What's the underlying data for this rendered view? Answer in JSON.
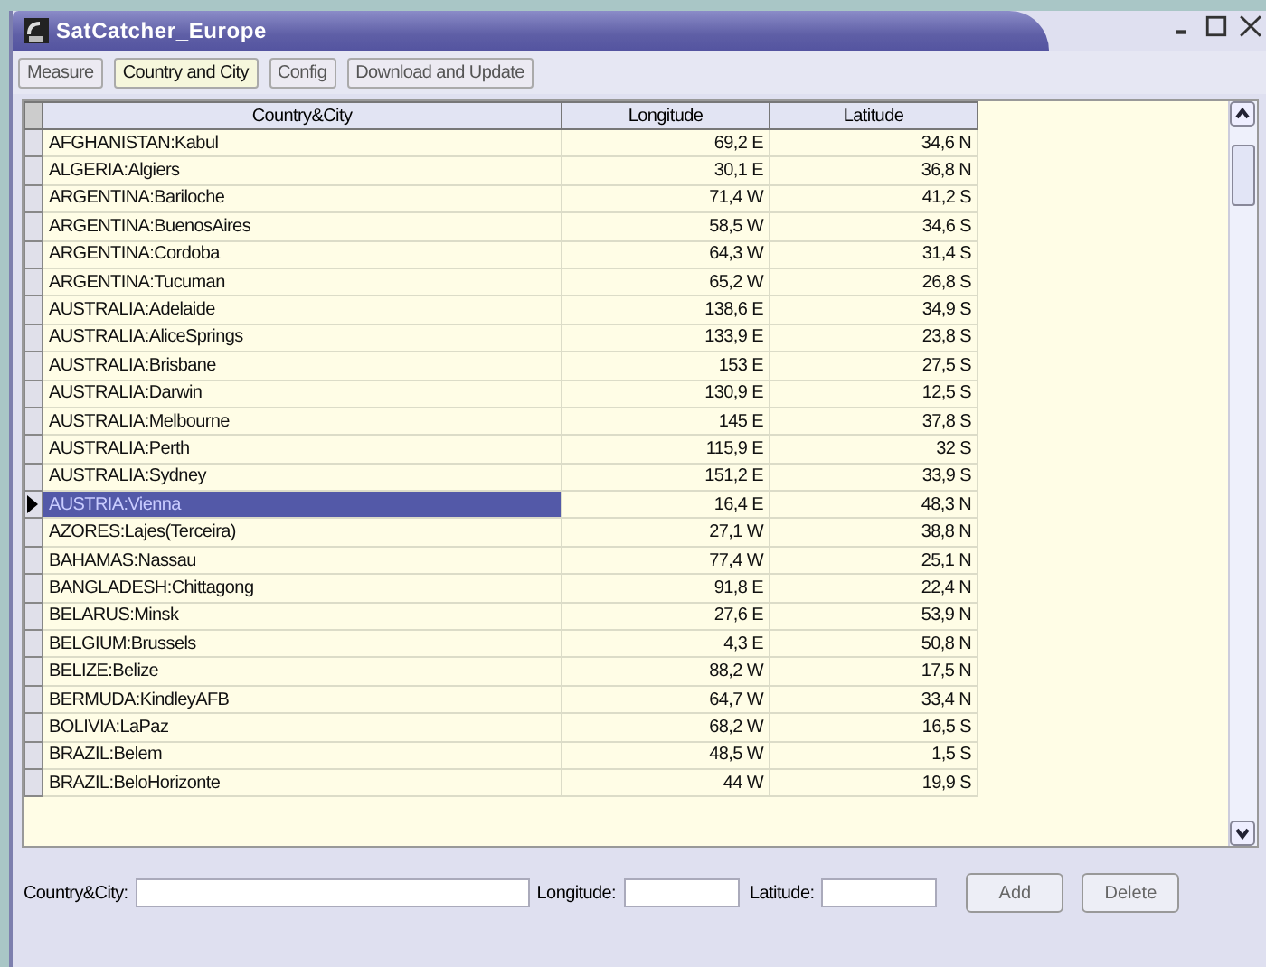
{
  "window": {
    "title": "SatCatcher_Europe"
  },
  "tabs": [
    {
      "label": "Measure",
      "selected": false
    },
    {
      "label": "Country and City",
      "selected": true
    },
    {
      "label": "Config",
      "selected": false
    },
    {
      "label": "Download and Update",
      "selected": false
    }
  ],
  "table": {
    "columns": [
      "Country&City",
      "Longitude",
      "Latitude"
    ],
    "rows": [
      {
        "cells": [
          "AFGHANISTAN:Kabul",
          "69,2 E",
          "34,6 N"
        ],
        "selected": false
      },
      {
        "cells": [
          "ALGERIA:Algiers",
          "30,1 E",
          "36,8 N"
        ],
        "selected": false
      },
      {
        "cells": [
          "ARGENTINA:Bariloche",
          "71,4 W",
          "41,2 S"
        ],
        "selected": false
      },
      {
        "cells": [
          "ARGENTINA:BuenosAires",
          "58,5 W",
          "34,6 S"
        ],
        "selected": false
      },
      {
        "cells": [
          "ARGENTINA:Cordoba",
          "64,3 W",
          "31,4 S"
        ],
        "selected": false
      },
      {
        "cells": [
          "ARGENTINA:Tucuman",
          "65,2 W",
          "26,8 S"
        ],
        "selected": false
      },
      {
        "cells": [
          "AUSTRALIA:Adelaide",
          "138,6 E",
          "34,9 S"
        ],
        "selected": false
      },
      {
        "cells": [
          "AUSTRALIA:AliceSprings",
          "133,9 E",
          "23,8 S"
        ],
        "selected": false
      },
      {
        "cells": [
          "AUSTRALIA:Brisbane",
          "153 E",
          "27,5 S"
        ],
        "selected": false
      },
      {
        "cells": [
          "AUSTRALIA:Darwin",
          "130,9 E",
          "12,5 S"
        ],
        "selected": false
      },
      {
        "cells": [
          "AUSTRALIA:Melbourne",
          "145 E",
          "37,8 S"
        ],
        "selected": false
      },
      {
        "cells": [
          "AUSTRALIA:Perth",
          "115,9 E",
          "32 S"
        ],
        "selected": false
      },
      {
        "cells": [
          "AUSTRALIA:Sydney",
          "151,2 E",
          "33,9 S"
        ],
        "selected": false
      },
      {
        "cells": [
          "AUSTRIA:Vienna",
          "16,4 E",
          "48,3 N"
        ],
        "selected": true
      },
      {
        "cells": [
          "AZORES:Lajes(Terceira)",
          "27,1 W",
          "38,8 N"
        ],
        "selected": false
      },
      {
        "cells": [
          "BAHAMAS:Nassau",
          "77,4 W",
          "25,1 N"
        ],
        "selected": false
      },
      {
        "cells": [
          "BANGLADESH:Chittagong",
          "91,8 E",
          "22,4 N"
        ],
        "selected": false
      },
      {
        "cells": [
          "BELARUS:Minsk",
          "27,6 E",
          "53,9 N"
        ],
        "selected": false
      },
      {
        "cells": [
          "BELGIUM:Brussels",
          "4,3 E",
          "50,8 N"
        ],
        "selected": false
      },
      {
        "cells": [
          "BELIZE:Belize",
          "88,2 W",
          "17,5 N"
        ],
        "selected": false
      },
      {
        "cells": [
          "BERMUDA:KindleyAFB",
          "64,7 W",
          "33,4 N"
        ],
        "selected": false
      },
      {
        "cells": [
          "BOLIVIA:LaPaz",
          "68,2 W",
          "16,5 S"
        ],
        "selected": false
      },
      {
        "cells": [
          "BRAZIL:Belem",
          "48,5 W",
          "1,5 S"
        ],
        "selected": false
      },
      {
        "cells": [
          "BRAZIL:BeloHorizonte",
          "44 W",
          "19,9 S"
        ],
        "selected": false
      }
    ]
  },
  "form": {
    "fields": [
      {
        "label": "Country&City:",
        "kind": "wide"
      },
      {
        "label": "Longitude:",
        "kind": "narrow"
      },
      {
        "label": "Latitude:",
        "kind": "narrow"
      }
    ],
    "buttons": [
      "Add",
      "Delete"
    ]
  }
}
